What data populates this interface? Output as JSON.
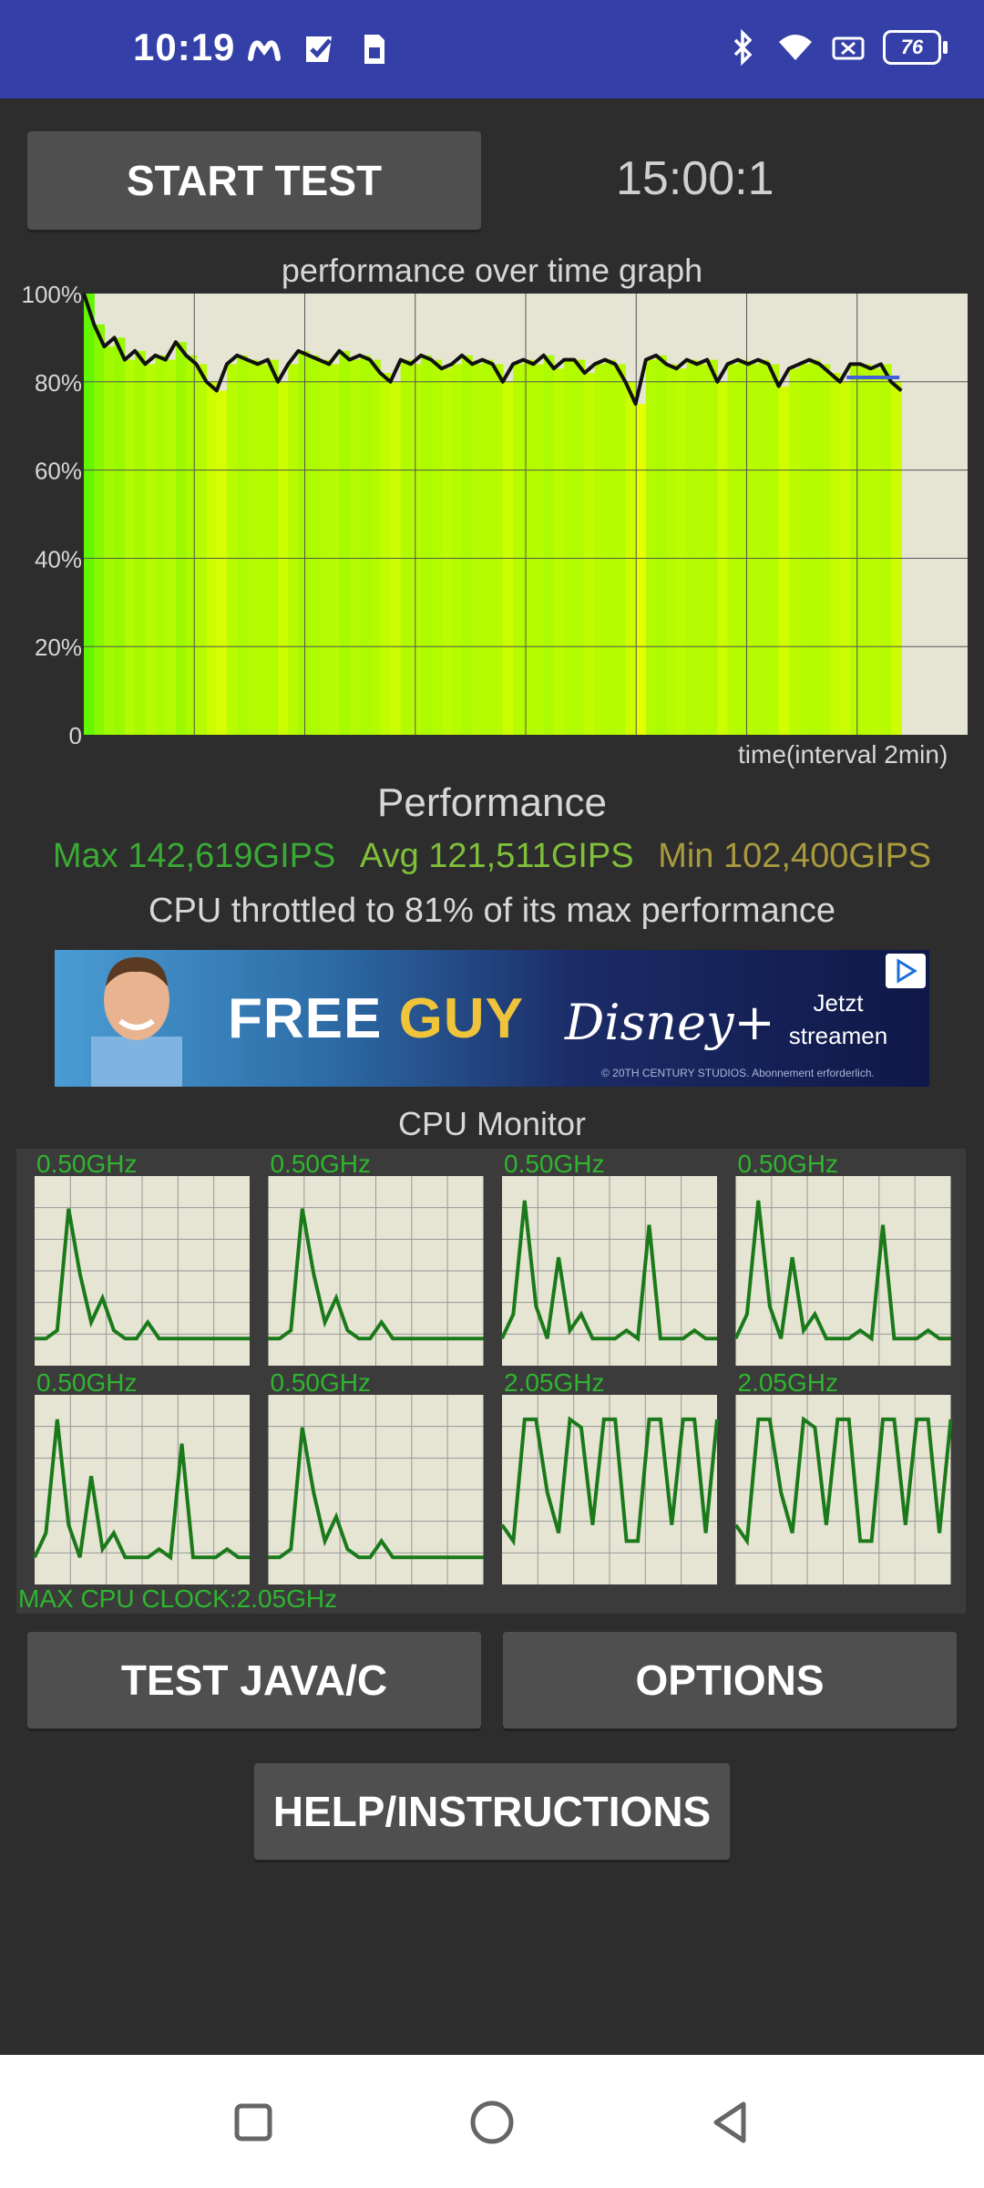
{
  "status_bar": {
    "time": "10:19",
    "left_icons": [
      "notification-m-icon",
      "check-flag-icon",
      "sim-card-icon"
    ],
    "right_icons": [
      "bluetooth-icon",
      "wifi-icon",
      "no-sim-icon"
    ],
    "battery": "76"
  },
  "controls": {
    "start_label": "START TEST",
    "timer": "15:00:1"
  },
  "graph": {
    "title": "performance over time graph",
    "y_ticks": [
      "100%",
      "80%",
      "60%",
      "40%",
      "20%",
      "0"
    ],
    "time_label": "time(interval 2min)"
  },
  "performance": {
    "title": "Performance",
    "max": "Max 142,619GIPS",
    "avg": "Avg 121,511GIPS",
    "min": "Min 102,400GIPS",
    "throttle": "CPU throttled to 81% of its max performance"
  },
  "ad": {
    "headline_a": "FREE ",
    "headline_b": "GUY",
    "brand": "Disney+",
    "cta": "Jetzt streamen",
    "fine_print": "© 20TH CENTURY STUDIOS. Abonnement erforderlich.",
    "badge_icon": "adchoices-icon"
  },
  "cpu_monitor": {
    "title": "CPU Monitor",
    "cores": [
      {
        "freq": "0.50GHz"
      },
      {
        "freq": "0.50GHz"
      },
      {
        "freq": "0.50GHz"
      },
      {
        "freq": "0.50GHz"
      },
      {
        "freq": "0.50GHz"
      },
      {
        "freq": "0.50GHz"
      },
      {
        "freq": "2.05GHz"
      },
      {
        "freq": "2.05GHz"
      }
    ],
    "max_clock": "MAX CPU CLOCK:2.05GHz"
  },
  "buttons": {
    "java": "TEST JAVA/C",
    "options": "OPTIONS",
    "help": "HELP/INSTRUCTIONS"
  },
  "nav": [
    "recent-apps-icon",
    "home-icon",
    "back-icon"
  ],
  "chart_data": {
    "type": "line",
    "title": "performance over time graph",
    "xlabel": "time(interval 2min)",
    "ylabel": "",
    "ylim": [
      0,
      100
    ],
    "y_ticks": [
      "0",
      "20%",
      "40%",
      "60%",
      "80%",
      "100%"
    ],
    "series": [
      {
        "values": [
          100,
          93,
          88,
          90,
          85,
          87,
          84,
          86,
          85,
          89,
          86,
          84,
          80,
          78,
          84,
          86,
          85,
          84,
          85,
          80,
          84,
          87,
          86,
          85,
          84,
          87,
          85,
          86,
          85,
          82,
          80,
          85,
          84,
          86,
          85,
          83,
          84,
          86,
          84,
          85,
          84,
          80,
          84,
          85,
          84,
          86,
          83,
          85,
          85,
          82,
          84,
          85,
          84,
          80,
          75,
          85,
          86,
          84,
          83,
          85,
          84,
          85,
          80,
          84,
          85,
          84,
          85,
          84,
          79,
          83,
          84,
          85,
          84,
          82,
          80,
          84,
          84,
          83,
          84,
          80,
          78
        ]
      }
    ]
  }
}
